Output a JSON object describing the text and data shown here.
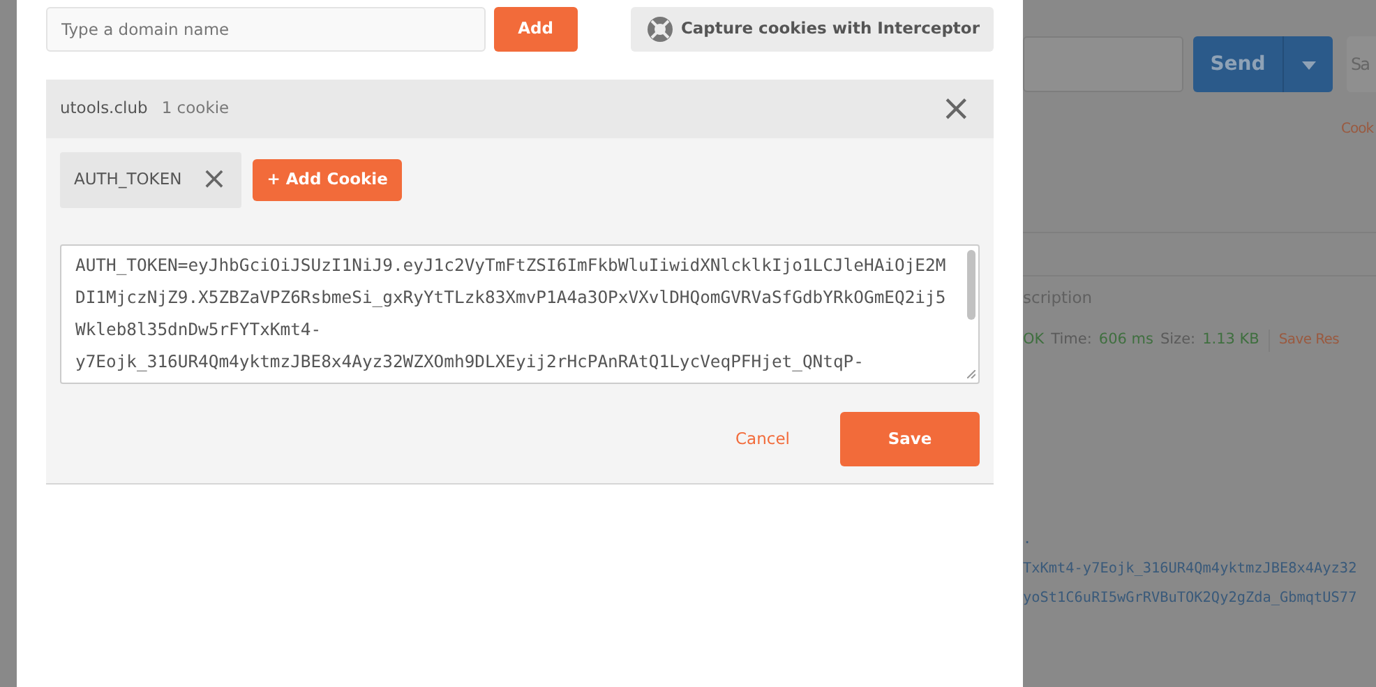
{
  "modal": {
    "domain_field": {
      "placeholder": "Type a domain name"
    },
    "add_button": "Add",
    "interceptor_button": "Capture cookies with Interceptor",
    "domain": {
      "name": "utools.club",
      "count": "1 cookie",
      "close": "×"
    },
    "cookies": [
      {
        "name": "AUTH_TOKEN",
        "selected": true,
        "remove": "×"
      }
    ],
    "add_cookie_button": "+ Add Cookie",
    "cookie_value": "AUTH_TOKEN=eyJhbGciOiJSUzI1NiJ9.eyJ1c2VyTmFtZSI6ImFkbWluIiwidXNlcklkIjo1LCJleHAiOjE2MDI1MjczNjZ9.X5ZBZaVPZ6RsbmeSi_gxRyYtTLzk83XmvP1A4a3OPxVXvlDHQomGVRVaSfGdbYRkOGmEQ2ij5Wkleb8l35dnDw5rFYTxKmt4-y7Eojk_316UR4Qm4yktmzJBE8x4Ayz32WZXOmh9DLXEyij2rHcPAnRAtQ1LycVeqPFHjet_QNtqP-",
    "cancel": "Cancel",
    "save": "Save"
  },
  "background": {
    "send_button": "Send",
    "save_button": "Sa",
    "cookies_link": "Cook",
    "description_tab": "scription",
    "status": [
      {
        "label": "OK"
      },
      {
        "label": "Time:",
        "value": "606 ms"
      },
      {
        "label": "Size:",
        "value": "1.13 KB"
      }
    ],
    "save_response": "Save Res",
    "body_lines": [
      ".",
      "TxKmt4-y7Eojk_316UR4Qm4yktmzJBE8x4Ayz32",
      "yoSt1C6uRI5wGrRVBuTOK2Qy2gZda_GbmqtUS77"
    ]
  }
}
